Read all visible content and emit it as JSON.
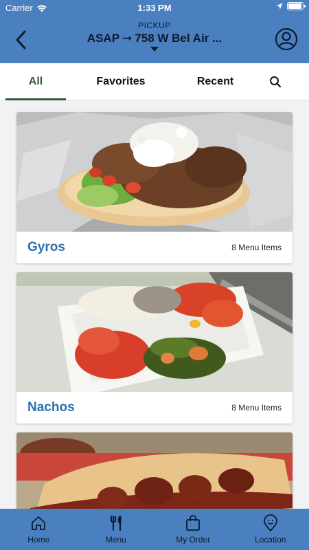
{
  "status": {
    "carrier": "Carrier",
    "time": "1:33 PM",
    "battery_level": 0.95
  },
  "header": {
    "pickup_label": "PICKUP",
    "when": "ASAP",
    "arrow": "➞",
    "address": "758 W Bel Air ..."
  },
  "tabs": [
    {
      "label": "All",
      "active": true
    },
    {
      "label": "Favorites",
      "active": false
    },
    {
      "label": "Recent",
      "active": false
    }
  ],
  "categories": [
    {
      "name": "Gyros",
      "count": "8 Menu Items"
    },
    {
      "name": "Nachos",
      "count": "8 Menu Items"
    }
  ],
  "bottom_nav": [
    {
      "label": "Home",
      "icon": "home-icon"
    },
    {
      "label": "Menu",
      "icon": "utensils-icon"
    },
    {
      "label": "My Order",
      "icon": "shopping-bag-icon"
    },
    {
      "label": "Location",
      "icon": "location-pin-icon"
    }
  ],
  "colors": {
    "brand": "#4a7fc0",
    "title_blue": "#2d6fb0",
    "active_tab": "#2f5f3a"
  }
}
